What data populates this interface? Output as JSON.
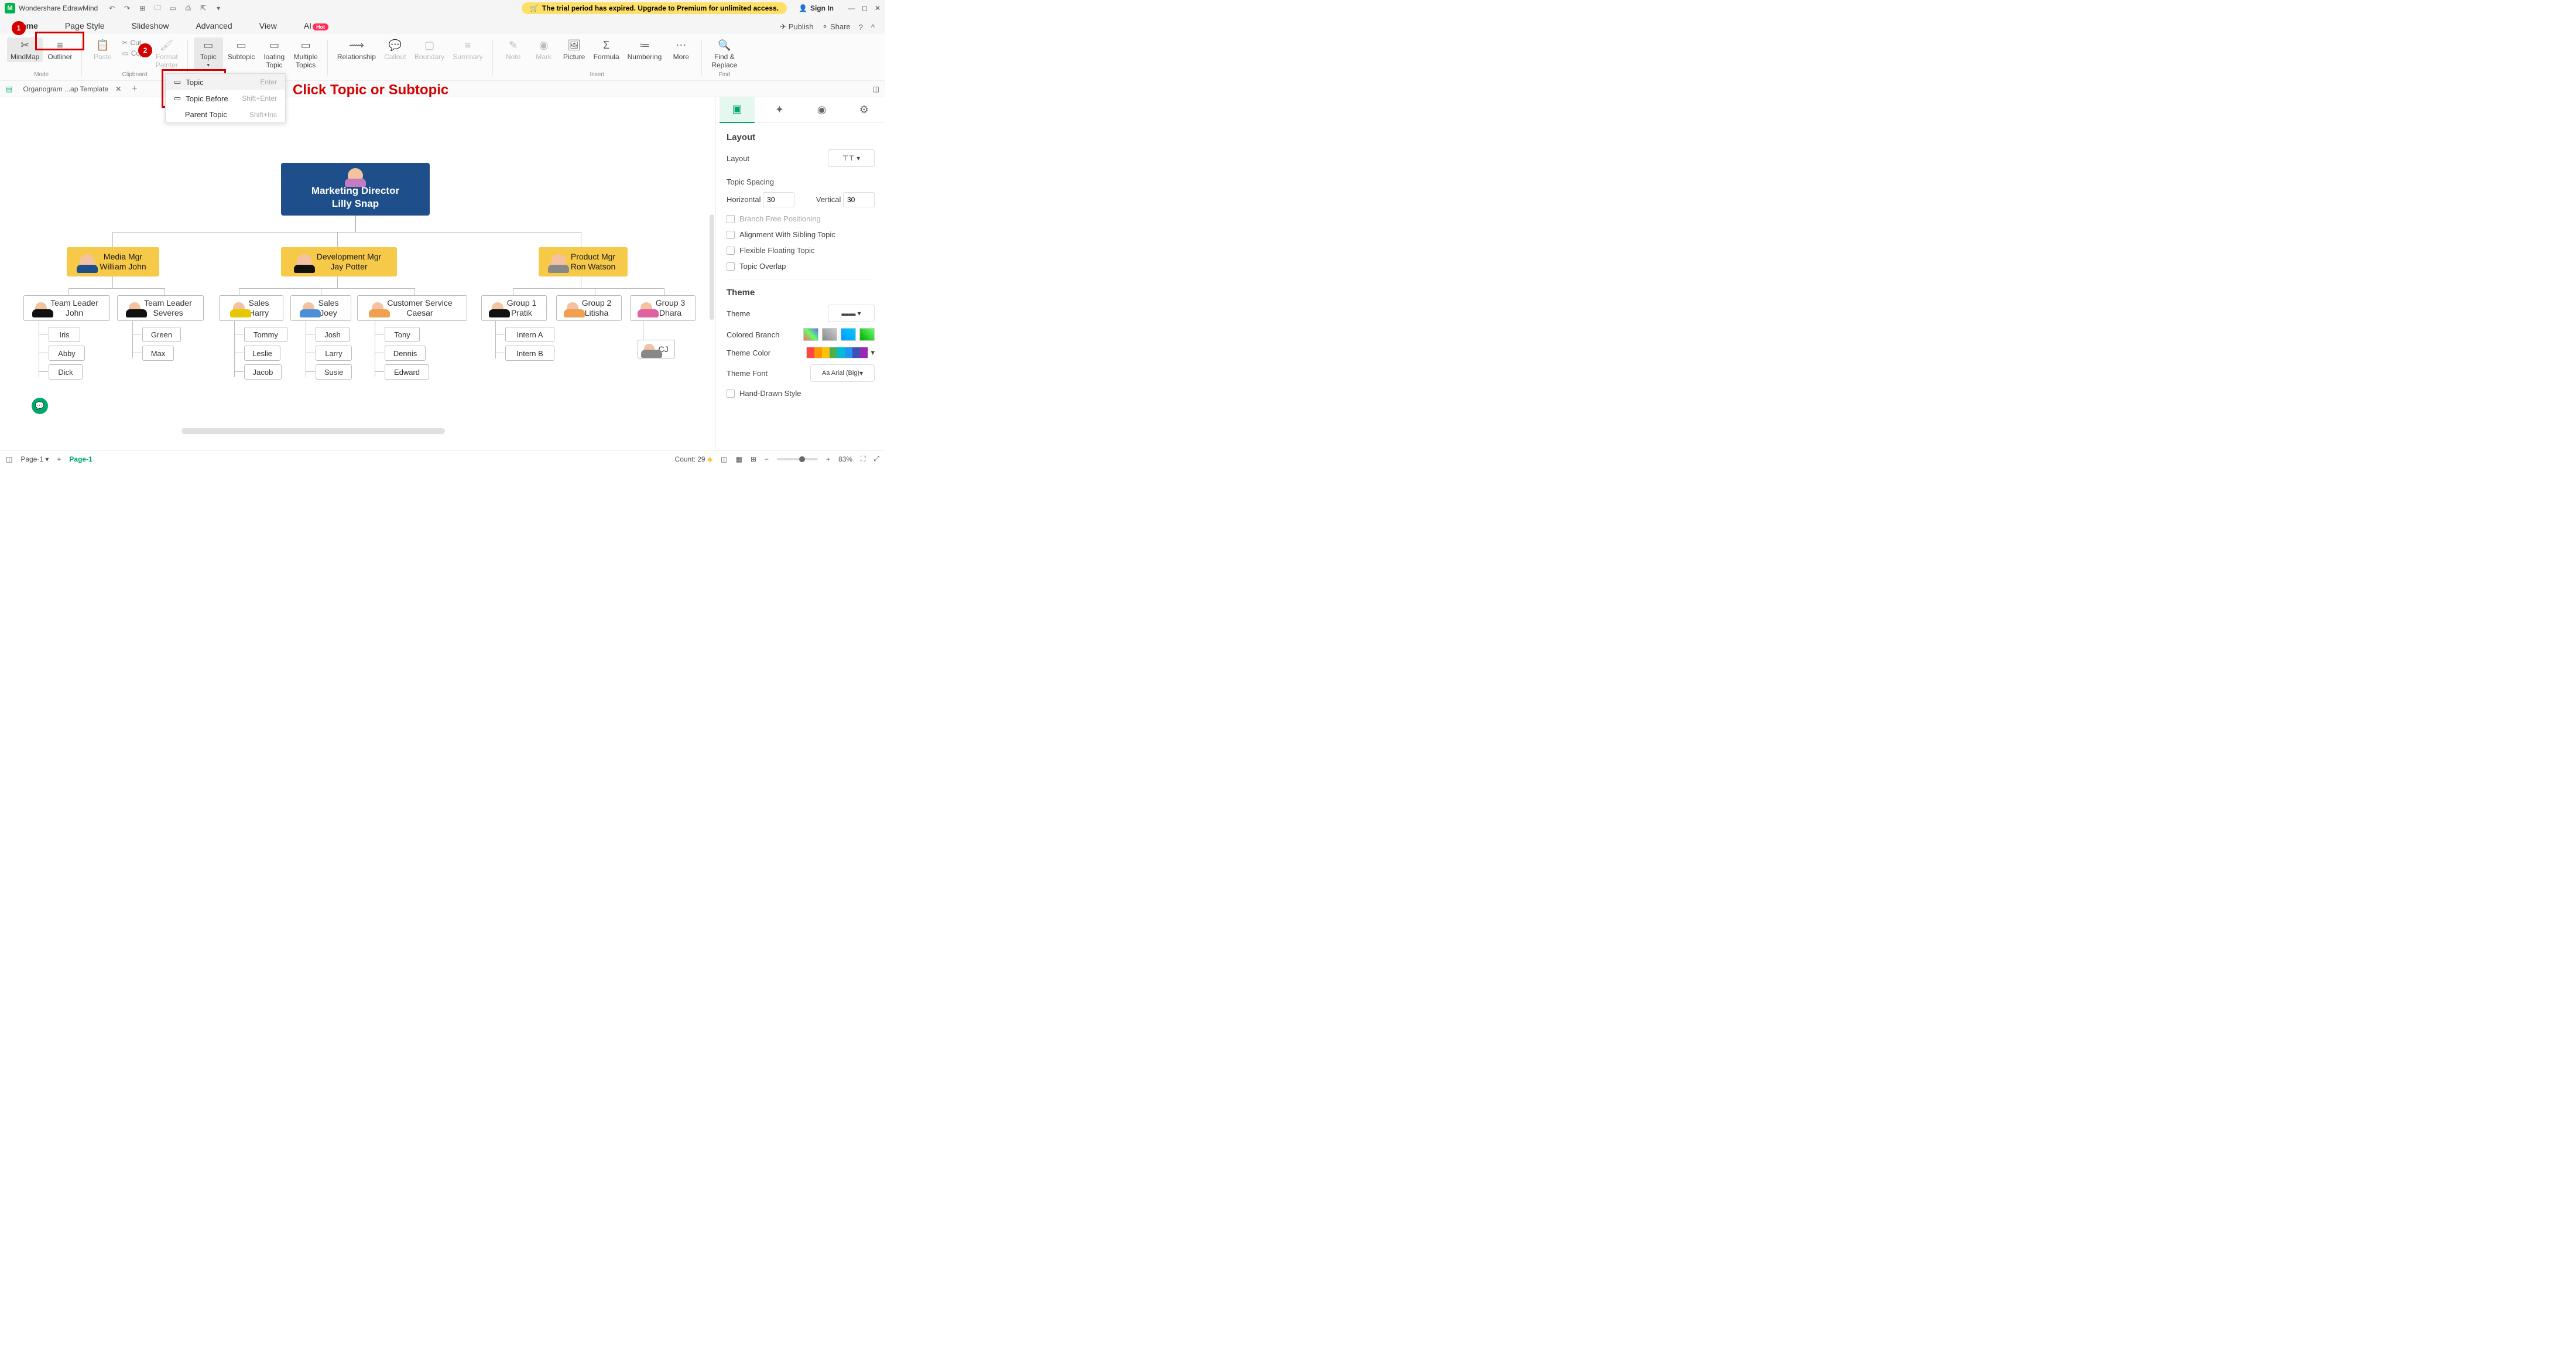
{
  "app": {
    "name": "Wondershare EdrawMind"
  },
  "trial_banner": "The trial period has expired. Upgrade to Premium for unlimited access.",
  "signin": "Sign In",
  "qat": [
    "↶",
    "↷",
    "+",
    "folder",
    "save",
    "print",
    "export",
    "⋯"
  ],
  "menu_tabs": [
    "Home",
    "Page Style",
    "Slideshow",
    "Advanced",
    "View",
    "AI"
  ],
  "menu_right": {
    "publish": "Publish",
    "share": "Share"
  },
  "ribbon": {
    "mode": {
      "mindmap": "MindMap",
      "outliner": "Outliner",
      "label": "Mode"
    },
    "clipboard": {
      "paste": "Paste",
      "cut": "Cut",
      "copy": "Copy",
      "fp": "Format\nPainter",
      "label": "Clipboard"
    },
    "topics": {
      "topic": "Topic",
      "subtopic": "Subtopic",
      "floating": "loating\nTopic",
      "multiple": "Multiple\nTopics"
    },
    "relationship": "Relationship",
    "callout": "Callout",
    "boundary": "Boundary",
    "summary": "Summary",
    "insert": {
      "label": "Insert",
      "note": "Note",
      "mark": "Mark",
      "picture": "Picture",
      "formula": "Formula",
      "numbering": "Numbering",
      "more": "More"
    },
    "find": {
      "label": "Find",
      "findreplace": "Find &\nReplace"
    }
  },
  "dropdown": [
    {
      "label": "Topic",
      "shortcut": "Enter"
    },
    {
      "label": "Topic Before",
      "shortcut": "Shift+Enter"
    },
    {
      "label": "Parent Topic",
      "shortcut": "Shift+Ins"
    }
  ],
  "doc_tab": "Organogram ...ap Template",
  "annotation_text": "Click Topic or Subtopic",
  "org": {
    "root": {
      "title": "Marketing Director",
      "name": "Lilly Snap"
    },
    "l2": [
      {
        "title": "Media Mgr",
        "name": "William John"
      },
      {
        "title": "Development Mgr",
        "name": "Jay Potter"
      },
      {
        "title": "Product Mgr",
        "name": "Ron Watson"
      }
    ],
    "l3": [
      {
        "title": "Team Leader",
        "name": "John"
      },
      {
        "title": "Team Leader",
        "name": "Severes"
      },
      {
        "title": "Sales",
        "name": "Harry"
      },
      {
        "title": "Sales",
        "name": "Joey"
      },
      {
        "title": "Customer Service",
        "name": "Caesar"
      },
      {
        "title": "Group 1",
        "name": "Pratik"
      },
      {
        "title": "Group 2",
        "name": "Litisha"
      },
      {
        "title": "Group 3",
        "name": "Dhara"
      }
    ],
    "l4": {
      "john": [
        "Iris",
        "Abby",
        "Dick"
      ],
      "severes": [
        "Green",
        "Max"
      ],
      "harry": [
        "Tommy",
        "Leslie",
        "Jacob"
      ],
      "joey": [
        "Josh",
        "Larry",
        "Susie"
      ],
      "caesar": [
        "Tony",
        "Dennis",
        "Edward"
      ],
      "pratik": [
        "Intern A",
        "Intern B"
      ],
      "dhara_cj": "CJ"
    }
  },
  "right_panel": {
    "layout_hdr": "Layout",
    "layout_label": "Layout",
    "topic_spacing": "Topic Spacing",
    "horizontal": "Horizontal",
    "horizontal_val": "30",
    "vertical": "Vertical",
    "vertical_val": "30",
    "branch_free": "Branch Free Positioning",
    "align_sibling": "Alignment With Sibling Topic",
    "flexible_float": "Flexible Floating Topic",
    "topic_overlap": "Topic Overlap",
    "theme_hdr": "Theme",
    "theme_label": "Theme",
    "colored_branch": "Colored Branch",
    "theme_color": "Theme Color",
    "theme_font": "Theme Font",
    "theme_font_val": "Arial (Big)",
    "hand_drawn": "Hand-Drawn Style"
  },
  "status": {
    "page": "Page-1",
    "page_active": "Page-1",
    "count": "Count: 29",
    "zoom": "83%"
  }
}
